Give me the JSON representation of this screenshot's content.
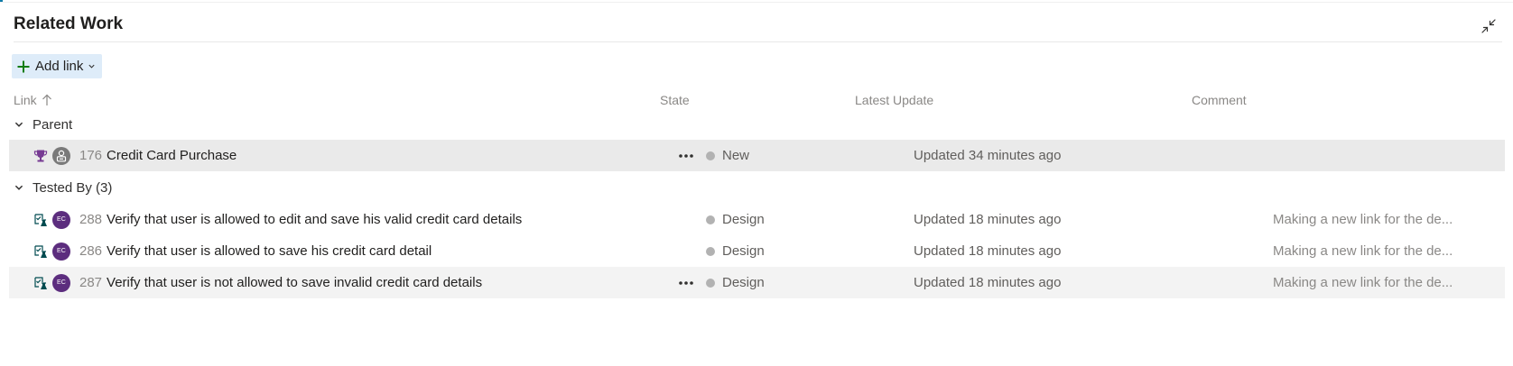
{
  "panel": {
    "title": "Related Work",
    "collapse_icon": "collapse-arrows-icon"
  },
  "toolbar": {
    "add_link_label": "Add link",
    "add_icon": "plus-icon",
    "dropdown_icon": "chevron-down-icon"
  },
  "columns": {
    "link": "Link",
    "link_sort": "ascending",
    "state": "State",
    "latest_update": "Latest Update",
    "comment": "Comment"
  },
  "colors": {
    "accent_green": "#107c10",
    "add_link_bg": "#deecf9",
    "avatar_purple": "#5c2d7e",
    "trophy_purple": "#773b93",
    "test_icon_teal": "#004b50",
    "state_dot_gray": "#b2b2b2"
  },
  "groups": [
    {
      "label": "Parent",
      "expanded": true,
      "items": [
        {
          "id": "176",
          "title": "Credit Card Purchase",
          "type_icon": "trophy-icon",
          "avatar": "unassigned-user-icon",
          "avatar_initials": "",
          "state": "New",
          "latest_update": "Updated 34 minutes ago",
          "comment": "",
          "show_more": true
        }
      ]
    },
    {
      "label": "Tested By (3)",
      "expanded": true,
      "items": [
        {
          "id": "288",
          "title": "Verify that user is allowed to edit and save his valid credit card details",
          "type_icon": "test-case-icon",
          "avatar": "user-avatar",
          "avatar_initials": "EC",
          "state": "Design",
          "latest_update": "Updated 18 minutes ago",
          "comment": "Making a new link for the de...",
          "show_more": false
        },
        {
          "id": "286",
          "title": "Verify that user is allowed to save his credit card detail",
          "type_icon": "test-case-icon",
          "avatar": "user-avatar",
          "avatar_initials": "EC",
          "state": "Design",
          "latest_update": "Updated 18 minutes ago",
          "comment": "Making a new link for the de...",
          "show_more": false
        },
        {
          "id": "287",
          "title": "Verify that user is not allowed to save invalid credit card details",
          "type_icon": "test-case-icon",
          "avatar": "user-avatar",
          "avatar_initials": "EC",
          "state": "Design",
          "latest_update": "Updated 18 minutes ago",
          "comment": "Making a new link for the de...",
          "show_more": true
        }
      ]
    }
  ]
}
